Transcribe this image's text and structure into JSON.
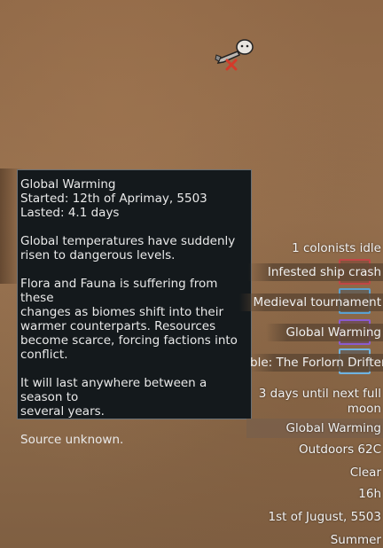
{
  "tooltip": {
    "title": "Global Warming",
    "started": "Started: 12th of Aprimay, 5503",
    "lasted": "Lasted: 4.1 days",
    "paragraph1": "Global temperatures have suddenly\nrisen to dangerous levels.",
    "paragraph2": "Flora and Fauna is suffering from these\nchanges as biomes shift into their\nwarmer counterparts. Resources\nbecome scarce, forcing factions into\nconflict.",
    "paragraph3": "It will last anywhere between a season to\nseveral years.",
    "paragraph4": "Source unknown."
  },
  "alerts": {
    "colonists_idle": "1 colonists idle"
  },
  "letters": [
    {
      "label": "Infested ship crash",
      "color": "#c04646"
    },
    {
      "label": "Medieval tournament",
      "color": "#5aa0d0"
    },
    {
      "label": "Global Warming",
      "color": "#8b5ad0"
    },
    {
      "label": "ble: The Forlorn Drifter",
      "color": "#6fb3e0"
    }
  ],
  "status": {
    "moon": "3 days until next full\nmoon",
    "condition": "Global Warming",
    "temperature": "Outdoors 62C",
    "weather": "Clear",
    "time": "16h",
    "date": "1st of Jugust, 5503",
    "season": "Summer"
  },
  "icons": {
    "pawn": "colonist-pawn-icon",
    "mark": "red-x-icon"
  }
}
